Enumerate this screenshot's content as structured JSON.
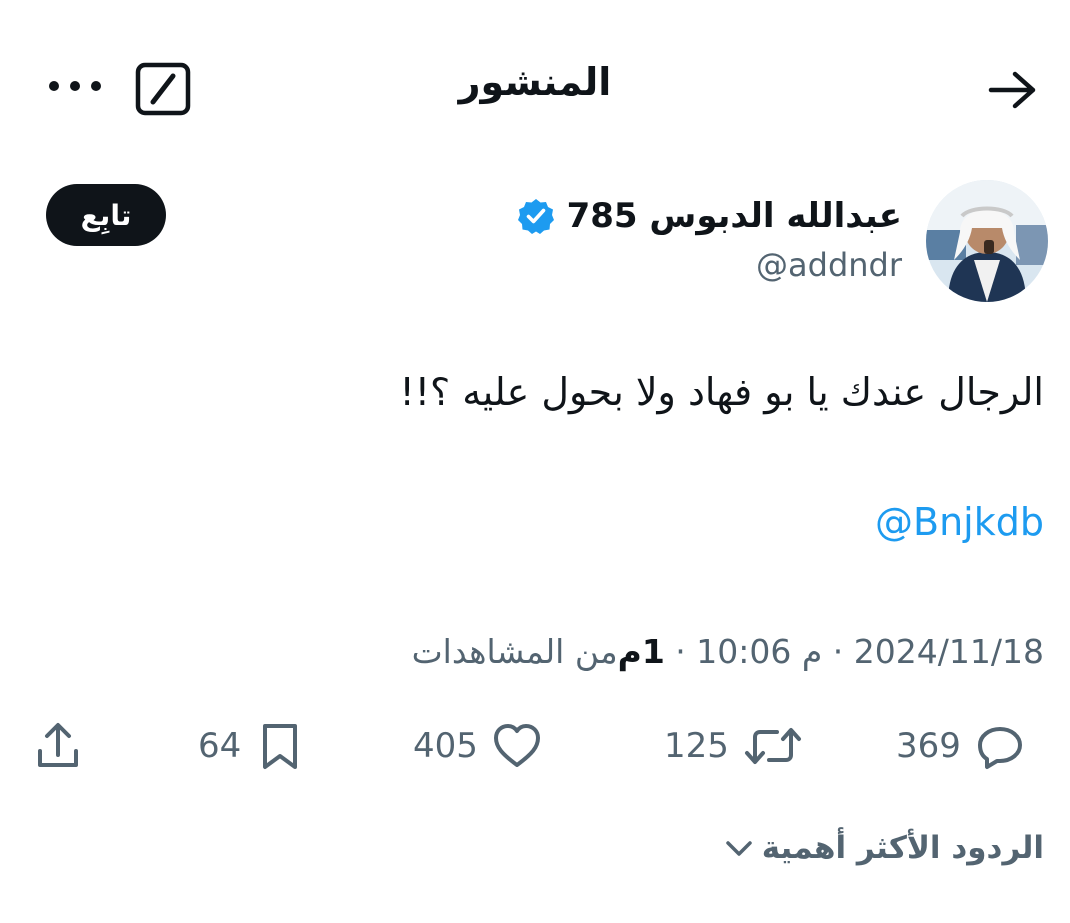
{
  "header": {
    "title": "المنشور",
    "back_icon": "arrow-right-icon",
    "compose_icon": "compose-icon",
    "more_icon": "more-horizontal-icon"
  },
  "author": {
    "display_name": "عبدالله الدبوس 785",
    "handle": "@addndr",
    "verified": true,
    "avatar_icon": "avatar"
  },
  "follow_button": {
    "label": "تابِع"
  },
  "post": {
    "text": "الرجال عندك يا بو فهاد ولا بحول عليه ؟!!",
    "mention": "@Bnjkdb"
  },
  "meta": {
    "date": "2024/11/18",
    "separator1": " · ",
    "time": "10:06 م",
    "separator2": " · ",
    "views_count": "1م",
    "views_label": " من المشاهدات"
  },
  "actions": {
    "replies": "369",
    "retweets": "125",
    "likes": "405",
    "bookmarks": "64"
  },
  "replies_sort": {
    "label": "الردود الأكثر أهمية"
  },
  "colors": {
    "text": "#0f1419",
    "secondary": "#536471",
    "accent": "#1d9bf0",
    "verified": "#1d9bf0",
    "button_bg": "#0f1419"
  }
}
